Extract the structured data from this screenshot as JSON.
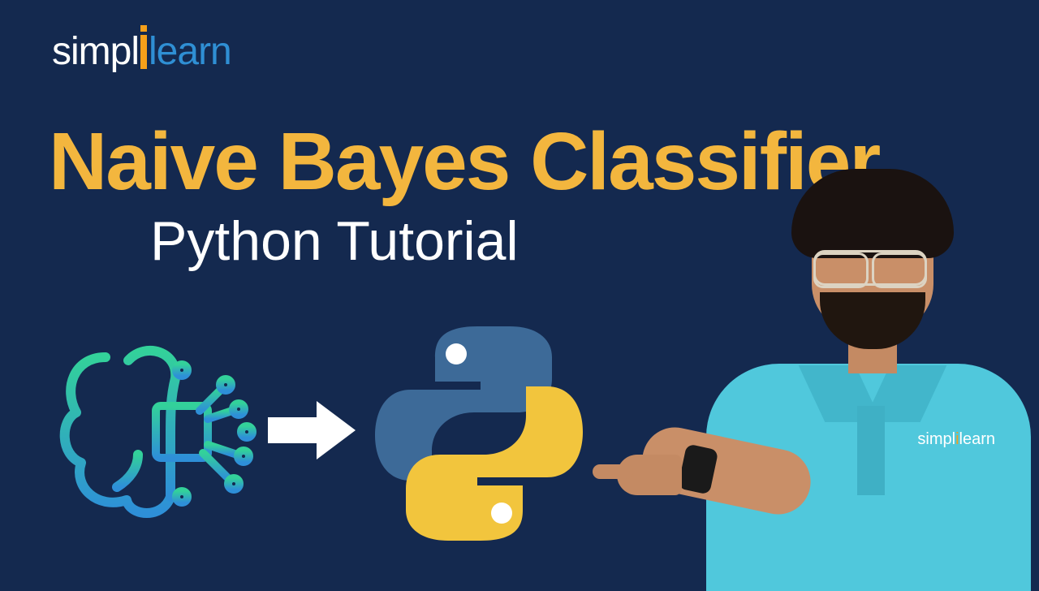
{
  "logo": {
    "part1": "simpl",
    "part2": "learn"
  },
  "title": "Naive Bayes Classifier",
  "subtitle": "Python Tutorial",
  "shirt_logo": {
    "pre": "simpl",
    "post": "learn"
  },
  "icons": {
    "brain": "ai-brain-chip-icon",
    "arrow": "right-arrow-icon",
    "python": "python-logo-icon"
  }
}
